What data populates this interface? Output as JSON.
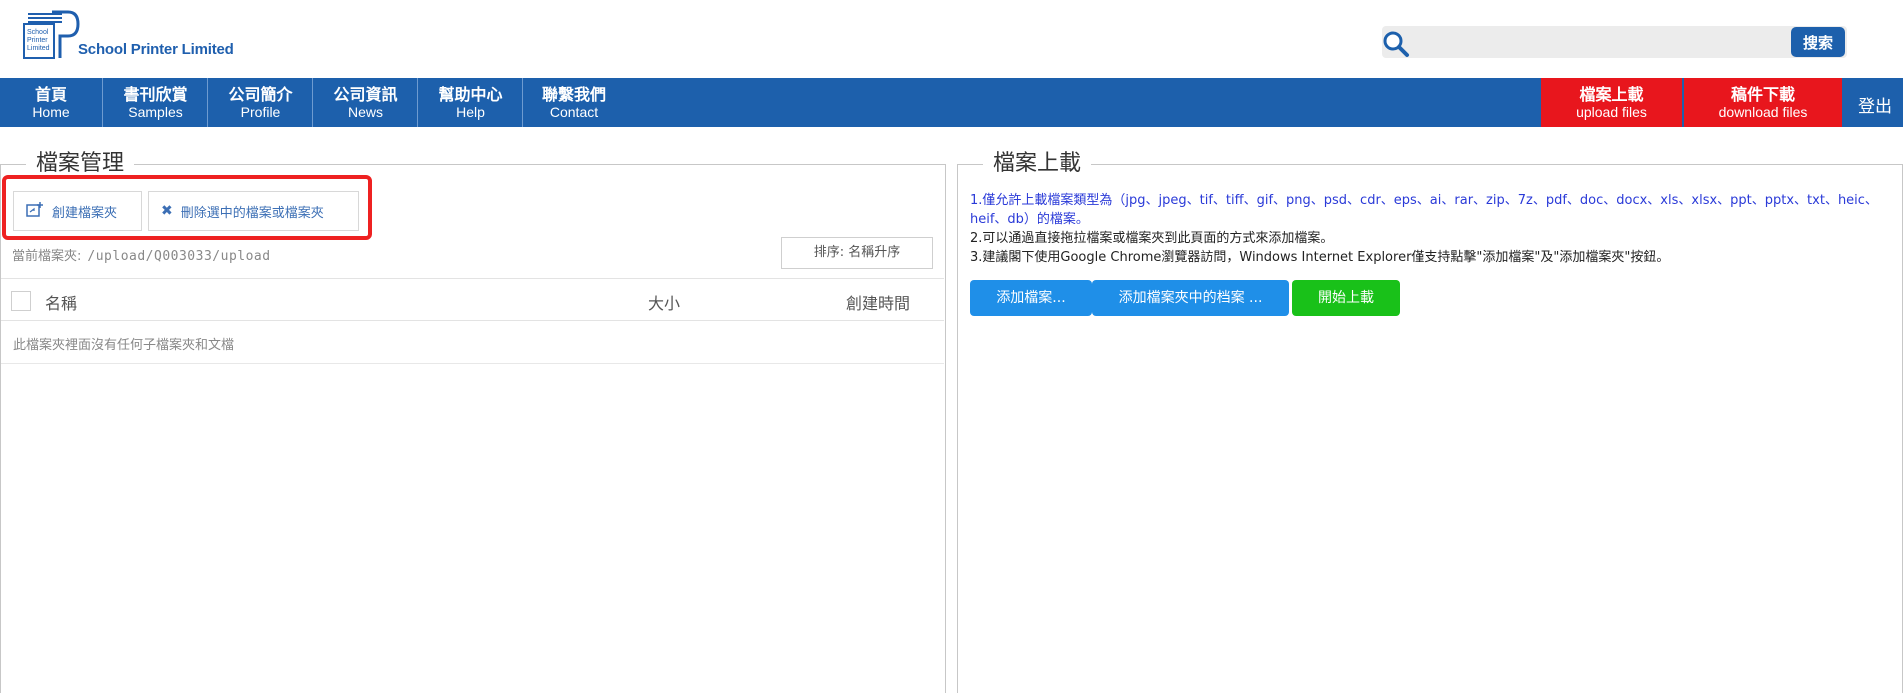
{
  "brand": {
    "logo_lettering": "School Printer Limited",
    "name": "School Printer Limited"
  },
  "search": {
    "placeholder": "",
    "button_label": "搜索"
  },
  "nav": {
    "items": [
      {
        "zh": "首頁",
        "en": "Home"
      },
      {
        "zh": "書刊欣賞",
        "en": "Samples"
      },
      {
        "zh": "公司簡介",
        "en": "Profile"
      },
      {
        "zh": "公司資訊",
        "en": "News"
      },
      {
        "zh": "幫助中心",
        "en": "Help"
      },
      {
        "zh": "聯繫我們",
        "en": "Contact"
      }
    ],
    "upload": {
      "zh": "檔案上載",
      "en": "upload files"
    },
    "download": {
      "zh": "稿件下載",
      "en": "download files"
    },
    "logout": "登出"
  },
  "file_manager": {
    "title": "檔案管理",
    "create_folder": "創建檔案夾",
    "delete_selected": "刪除選中的檔案或檔案夾",
    "current_folder_label": "當前檔案夾:",
    "current_folder_path": "/upload/Q003033/upload",
    "sort_label": "排序: 名稱升序",
    "columns": [
      "名稱",
      "大小",
      "創建時間"
    ],
    "empty_message": "此檔案夾裡面沒有任何子檔案夾和文檔"
  },
  "upload_panel": {
    "title": "檔案上載",
    "note1": "1.僅允許上載檔案類型為（jpg、jpeg、tif、tiff、gif、png、psd、cdr、eps、ai、rar、zip、7z、pdf、doc、docx、xls、xlsx、ppt、pptx、txt、heic、heif、db）的檔案。",
    "note2": "2.可以通過直接拖拉檔案或檔案夾到此頁面的方式來添加檔案。",
    "note3": "3.建議閣下使用Google Chrome瀏覽器訪問，Windows Internet Explorer僅支持點擊\"添加檔案\"及\"添加檔案夾\"按鈕。",
    "add_files": "添加檔案...",
    "add_folder_files": "添加檔案夾中的档案 ...",
    "start_upload": "開始上載"
  },
  "colors": {
    "nav_blue": "#1d60ac",
    "nav_red": "#e8161d",
    "add_btn_blue": "#1f8fe8",
    "start_green": "#19c119",
    "highlight_red": "#ee2121"
  }
}
